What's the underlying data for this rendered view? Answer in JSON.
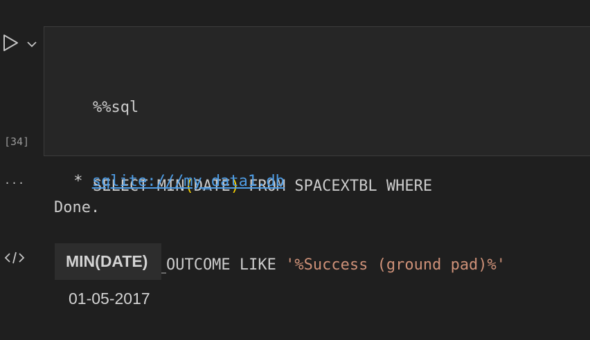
{
  "cell": {
    "execution_count": "[34]",
    "code": {
      "line1": "%%sql",
      "line2_select": "SELECT MIN",
      "line2_open": "(",
      "line2_col": "DATE",
      "line2_close": ")",
      "line2_rest": " FROM SPACEXTBL WHERE",
      "line3_prefix": "LANDING_OUTCOME LIKE ",
      "line3_string": "'%Success (ground pad)%'"
    }
  },
  "output": {
    "more_label": "...",
    "connection_prefix": " * ",
    "connection_link": "sqlite:///my_data1.db",
    "status": "Done.",
    "table": {
      "header": "MIN(DATE)",
      "value": "01-05-2017"
    }
  },
  "colors": {
    "background": "#1f1f1f",
    "cell_background": "#262626",
    "string": "#ce9178",
    "bracket": "#ffd700",
    "link": "#4e9de6"
  },
  "icons": {
    "run": "play-icon",
    "run_menu": "chevron-down-icon",
    "output_mime": "code-icon"
  }
}
